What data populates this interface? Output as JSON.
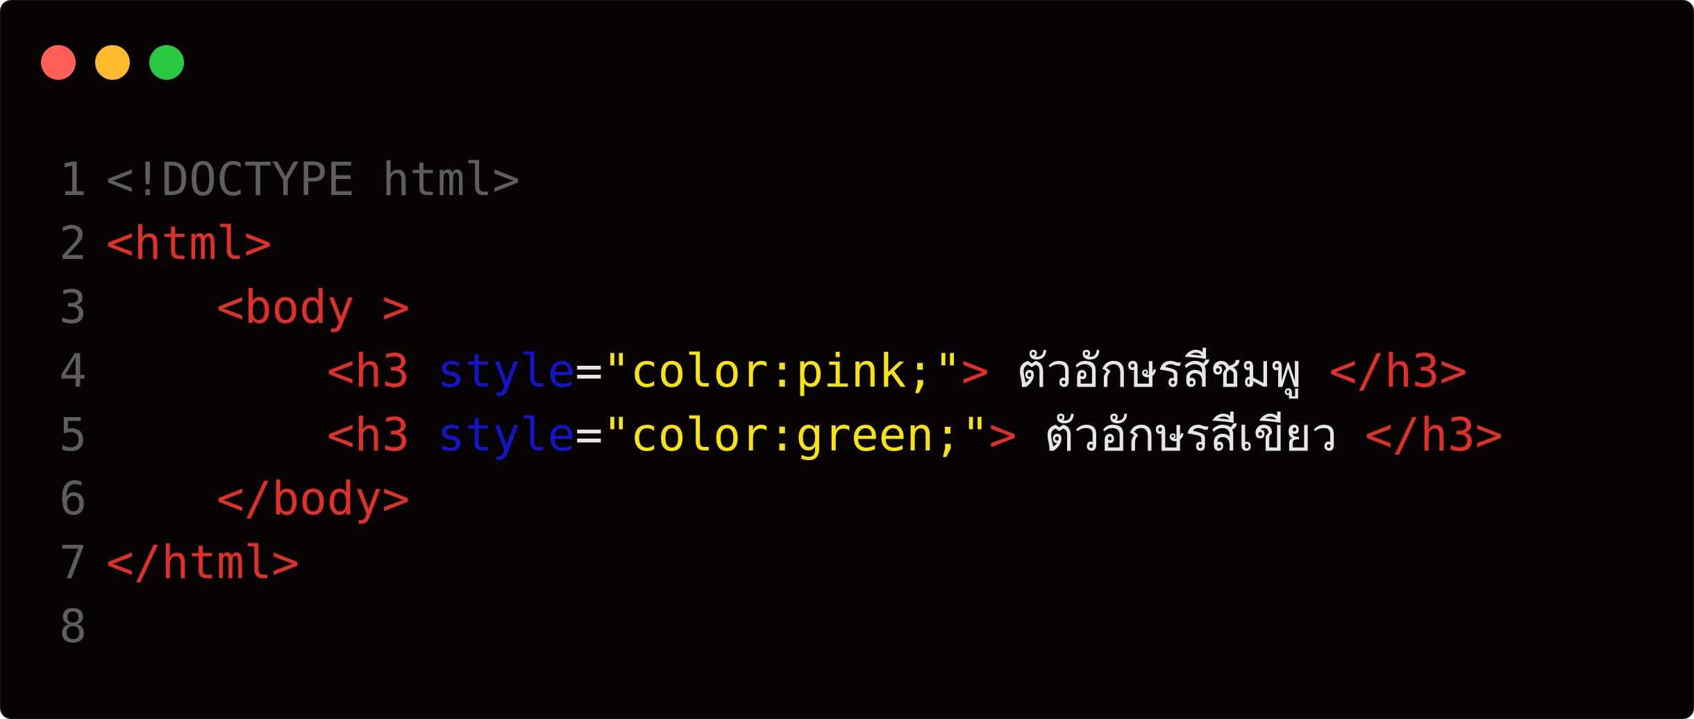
{
  "window": {
    "traffic_lights": [
      {
        "name": "close",
        "color": "#ff5f57"
      },
      {
        "name": "minimize",
        "color": "#febc2e"
      },
      {
        "name": "maximize",
        "color": "#28c840"
      }
    ]
  },
  "colors": {
    "doctype": "#5e5e5e",
    "tag": "#e0302a",
    "attr": "#1414c8",
    "punct": "#e6e6e6",
    "string": "#f7e214",
    "text": "#e6e6e6",
    "gutter": "#5e5e5e"
  },
  "lines": [
    {
      "num": "1",
      "tokens": [
        {
          "t": "<!DOCTYPE html>",
          "k": "doctype"
        }
      ]
    },
    {
      "num": "2",
      "tokens": [
        {
          "t": "<html>",
          "k": "tag"
        }
      ]
    },
    {
      "num": "3",
      "tokens": [
        {
          "t": "    ",
          "k": "text"
        },
        {
          "t": "<body >",
          "k": "tag"
        }
      ]
    },
    {
      "num": "4",
      "tokens": [
        {
          "t": "        ",
          "k": "text"
        },
        {
          "t": "<h3 ",
          "k": "tag"
        },
        {
          "t": "style",
          "k": "attr"
        },
        {
          "t": "=",
          "k": "punct"
        },
        {
          "t": "\"color:pink;\"",
          "k": "string"
        },
        {
          "t": ">",
          "k": "tag"
        },
        {
          "t": " ตัวอักษรสีชมพู ",
          "k": "text"
        },
        {
          "t": "</h3>",
          "k": "tag"
        }
      ]
    },
    {
      "num": "5",
      "tokens": [
        {
          "t": "        ",
          "k": "text"
        },
        {
          "t": "<h3 ",
          "k": "tag"
        },
        {
          "t": "style",
          "k": "attr"
        },
        {
          "t": "=",
          "k": "punct"
        },
        {
          "t": "\"color:green;\"",
          "k": "string"
        },
        {
          "t": ">",
          "k": "tag"
        },
        {
          "t": " ตัวอักษรสีเขียว ",
          "k": "text"
        },
        {
          "t": "</h3>",
          "k": "tag"
        }
      ]
    },
    {
      "num": "6",
      "tokens": [
        {
          "t": "    ",
          "k": "text"
        },
        {
          "t": "</body>",
          "k": "tag"
        }
      ]
    },
    {
      "num": "7",
      "tokens": [
        {
          "t": "</html>",
          "k": "tag"
        }
      ]
    },
    {
      "num": "8",
      "tokens": []
    }
  ]
}
